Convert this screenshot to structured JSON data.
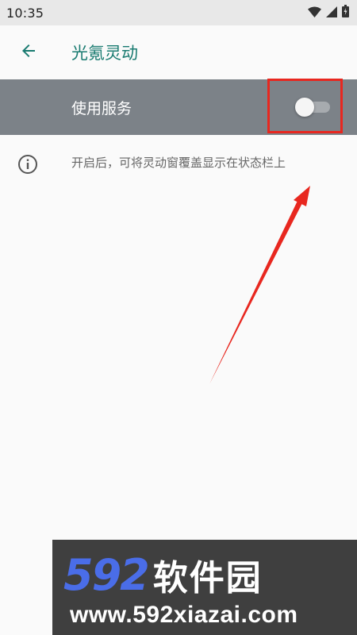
{
  "status_bar": {
    "time": "10:35",
    "icons": [
      "wifi-icon",
      "cell-signal-icon",
      "battery-icon"
    ]
  },
  "app_bar": {
    "back_icon": "arrow-left-icon",
    "title": "光氪灵动",
    "title_color": "#187a70"
  },
  "service_row": {
    "label": "使用服务",
    "toggle_on": false,
    "background": "#7c8288"
  },
  "info_row": {
    "icon": "info-icon",
    "text": "开启后，可将灵动窗覆盖显示在状态栏上"
  },
  "annotation": {
    "color": "#e8271f"
  },
  "watermark": {
    "number": "592",
    "brand": "软件园",
    "url": "www.592xiazai.com"
  }
}
